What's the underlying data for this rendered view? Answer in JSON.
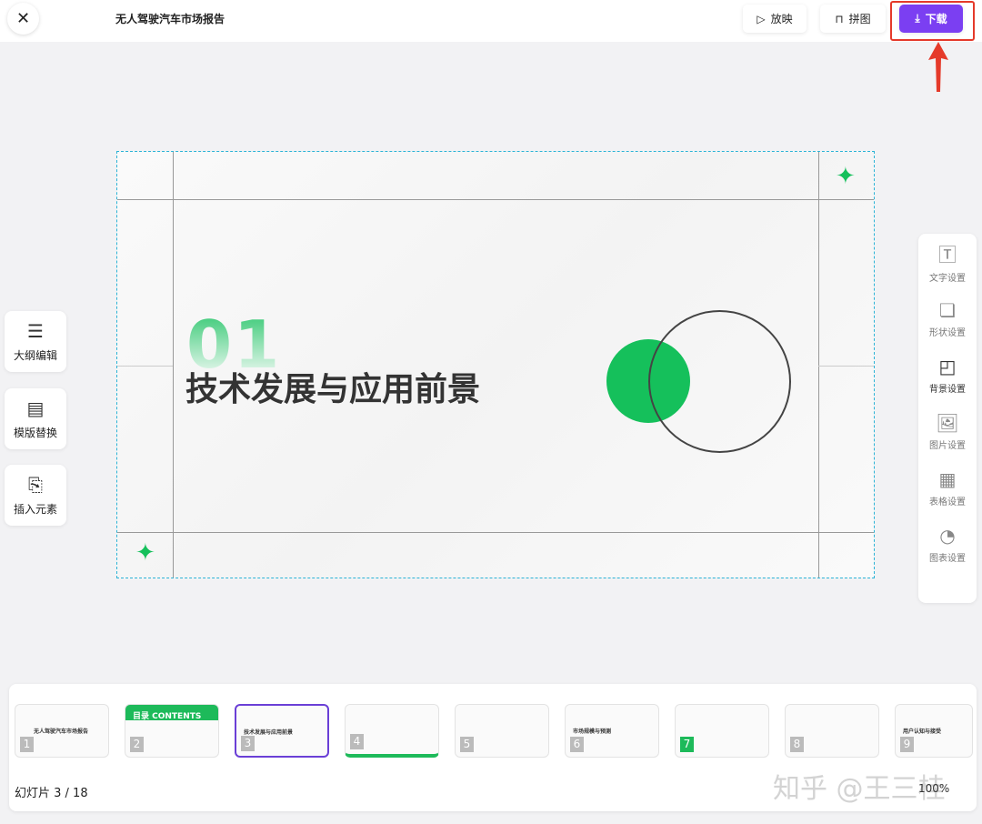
{
  "header": {
    "title": "无人驾驶汽车市场报告",
    "play_label": "放映",
    "collage_label": "拼图",
    "download_label": "下载"
  },
  "slide": {
    "number": "01",
    "heading": "技术发展与应用前景"
  },
  "left_tools": [
    {
      "label": "大纲编辑",
      "icon": "outline-icon"
    },
    {
      "label": "模版替换",
      "icon": "template-icon"
    },
    {
      "label": "插入元素",
      "icon": "insert-icon"
    }
  ],
  "right_tools": [
    {
      "label": "文字设置",
      "icon": "text-icon"
    },
    {
      "label": "形状设置",
      "icon": "shape-icon"
    },
    {
      "label": "背景设置",
      "icon": "background-icon"
    },
    {
      "label": "图片设置",
      "icon": "image-icon"
    },
    {
      "label": "表格设置",
      "icon": "table-icon"
    },
    {
      "label": "图表设置",
      "icon": "chart-icon"
    }
  ],
  "thumbnails": [
    {
      "num": "1",
      "text": "无人驾驶汽车市场报告"
    },
    {
      "num": "2",
      "text": "目录 CONTENTS"
    },
    {
      "num": "3",
      "text": "技术发展与应用前景"
    },
    {
      "num": "4",
      "text": ""
    },
    {
      "num": "5",
      "text": ""
    },
    {
      "num": "6",
      "text": "市场规模与预测"
    },
    {
      "num": "7",
      "text": ""
    },
    {
      "num": "8",
      "text": ""
    },
    {
      "num": "9",
      "text": "用户认知与接受"
    }
  ],
  "footer": {
    "counter": "幻灯片  3 / 18",
    "zoom": "100%",
    "watermark": "知乎 @王三桂"
  },
  "colors": {
    "accent": "#7b3ff2",
    "green": "#15c05b",
    "highlight": "#e53a2a"
  }
}
